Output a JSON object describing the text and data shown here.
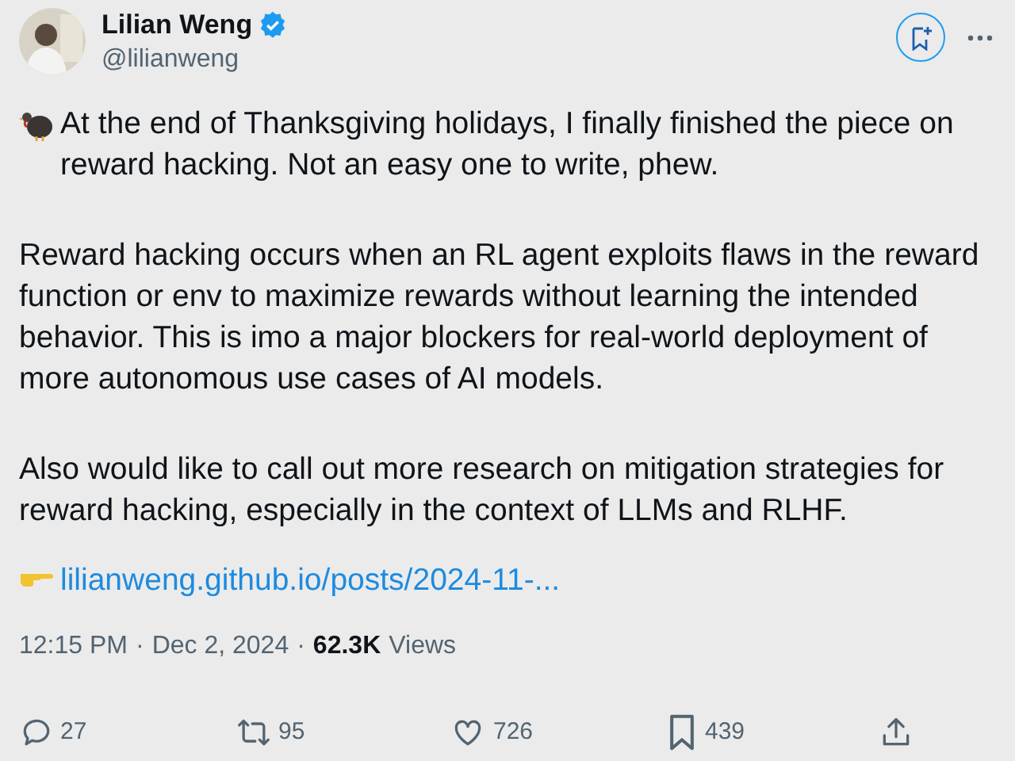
{
  "author": {
    "name": "Lilian Weng",
    "handle": "@lilianweng",
    "verified": true
  },
  "paragraphs": [
    "At the end of Thanksgiving holidays, I finally finished the piece on reward hacking. Not an easy one to write, phew.",
    "Reward hacking occurs when an RL agent exploits flaws in the reward function or env to maximize rewards without learning the intended behavior. This is imo a major blockers for real-world deployment of more autonomous use cases of AI models.",
    "Also would like to call out more research on mitigation strategies for reward hacking, especially in the context of LLMs and RLHF."
  ],
  "link": "lilianweng.github.io/posts/2024-11-...",
  "meta": {
    "time": "12:15 PM",
    "separator": "·",
    "date": "Dec 2, 2024",
    "views_count": "62.3K",
    "views_label": "Views"
  },
  "actions": [
    {
      "kind": "reply",
      "count": "27"
    },
    {
      "kind": "repost",
      "count": "95"
    },
    {
      "kind": "like",
      "count": "726"
    },
    {
      "kind": "bookmark",
      "count": "439"
    },
    {
      "kind": "share"
    }
  ]
}
